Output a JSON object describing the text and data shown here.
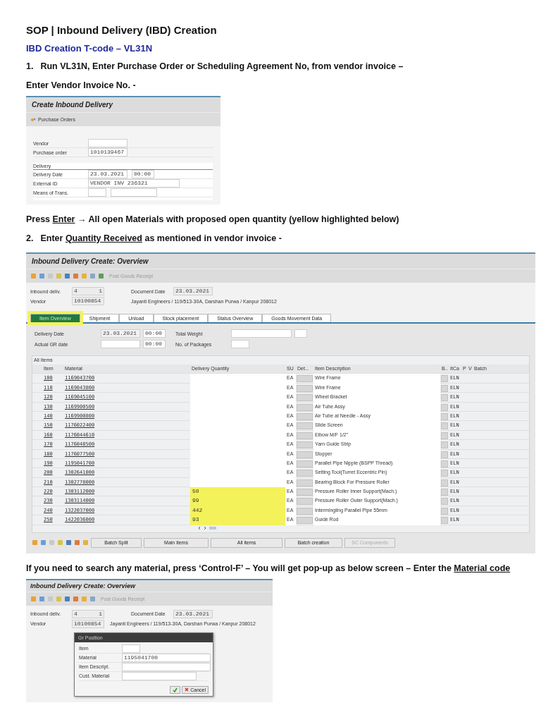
{
  "title": "SOP | Inbound Delivery (IBD) Creation",
  "subtitle": "IBD Creation T-code – VL31N",
  "step1": {
    "number": "1.",
    "text": [
      {
        "text": "Run VL31N, Enter Purchase Order or Scheduling Agreement No, from vendor invoice –",
        "underline": false
      }
    ]
  },
  "note1": [
    {
      "text": "Enter Vendor Invoice No. -",
      "underline": false
    }
  ],
  "screen1": {
    "title": "Create Inbound Delivery",
    "toolbar_button": "Purchase Orders",
    "fields": [
      {
        "label": "Vendor",
        "inputs": [
          {
            "kind": "empty"
          }
        ]
      },
      {
        "label": "Purchase order",
        "inputs": [
          {
            "kind": "filled",
            "value": "1010139467"
          }
        ]
      }
    ],
    "group": "Delivery",
    "group_fields": [
      {
        "label": "Delivery Date",
        "inputs": [
          {
            "kind": "filled",
            "value": "23.03.2021"
          },
          {
            "kind": "filled",
            "value": "00:00"
          }
        ]
      },
      {
        "label": "External ID",
        "inputs": [
          {
            "kind": "filled",
            "value": "VENDOR INV 236321"
          }
        ]
      },
      {
        "label": "Means of Trans.",
        "inputs": [
          {
            "kind": "empty"
          },
          {
            "kind": "empty"
          }
        ]
      }
    ]
  },
  "note2": [
    {
      "text": "Press ",
      "underline": false
    },
    {
      "text": "Enter",
      "underline": true
    },
    {
      "text": " → All open Materials with proposed open quantity (yellow highlighted below)",
      "underline": false
    }
  ],
  "step2": {
    "number": "2.",
    "text": [
      {
        "text": "Enter ",
        "underline": false
      },
      {
        "text": "Quantity Received",
        "underline": true
      },
      {
        "text": " as mentioned in vendor invoice -",
        "underline": false
      }
    ]
  },
  "screen2": {
    "title": "Inbound Delivery  Create: Overview",
    "toolbar_button": {
      "label": "Post Goods Receipt",
      "disabled": true
    },
    "header": {
      "inbound_label": "Inbound deliv.",
      "inbound_values": [
        "4",
        "1"
      ],
      "date_label": "Document Date",
      "date": "23.03.2021",
      "vendor_label": "Vendor",
      "vendor": "10100854",
      "address": "Jayanti Engineers / 119/513-30A, Darshan Purwa / Kanpur 208012"
    },
    "tabs": [
      {
        "label": "Item Overview",
        "selected": true,
        "highlighted": true
      },
      {
        "label": "Shipment",
        "selected": false,
        "highlighted": false
      },
      {
        "label": "Unload",
        "selected": false,
        "highlighted": false
      },
      {
        "label": "Stock placement",
        "selected": false,
        "highlighted": false
      },
      {
        "label": "Status Overview",
        "selected": false,
        "highlighted": false
      },
      {
        "label": "Goods Movement Data",
        "selected": false,
        "highlighted": false
      }
    ],
    "fields": {
      "delivery_date_label": "Delivery Date",
      "delivery_date": "23.03.2021",
      "delivery_time": "00:00",
      "gr_date_label": "Actual GR date",
      "gr_time": "00:00",
      "weight_label": "Total Weight",
      "packages_label": "No. of Packages"
    },
    "table": {
      "title": "All Items",
      "columns": [
        "Item",
        "Material",
        "Delivery Quantity",
        "SU",
        "Det...",
        "Item Description",
        "B..",
        "ItCa",
        "P",
        "V",
        "Batch"
      ],
      "rows": [
        {
          "item": "100",
          "material": "1169043700",
          "quantity": "",
          "su": "EA",
          "description": "Wire Frame",
          "itca": "ELN",
          "highlighted": false
        },
        {
          "item": "110",
          "material": "1169043800",
          "quantity": "",
          "su": "EA",
          "description": "Wire Frame",
          "itca": "ELN",
          "highlighted": false
        },
        {
          "item": "120",
          "material": "1169045100",
          "quantity": "",
          "su": "EA",
          "description": "Wheel Bracket",
          "itca": "ELN",
          "highlighted": false
        },
        {
          "item": "130",
          "material": "1169900500",
          "quantity": "",
          "su": "EA",
          "description": "Air Tube Assy",
          "itca": "ELN",
          "highlighted": false
        },
        {
          "item": "140",
          "material": "1169900800",
          "quantity": "",
          "su": "EA",
          "description": "Air Tube at Needle - Assy",
          "itca": "ELN",
          "highlighted": false
        },
        {
          "item": "150",
          "material": "1176022400",
          "quantity": "",
          "su": "EA",
          "description": "Slide Screen",
          "itca": "ELN",
          "highlighted": false
        },
        {
          "item": "160",
          "material": "1176044610",
          "quantity": "",
          "su": "EA",
          "description": "Elbow M/F 1/2\"",
          "itca": "ELN",
          "highlighted": false
        },
        {
          "item": "170",
          "material": "1176048500",
          "quantity": "",
          "su": "EA",
          "description": "Yarn Guide Strip",
          "itca": "ELN",
          "highlighted": false
        },
        {
          "item": "180",
          "material": "1176077500",
          "quantity": "",
          "su": "EA",
          "description": "Stopper",
          "itca": "ELN",
          "highlighted": false
        },
        {
          "item": "190",
          "material": "1195041700",
          "quantity": "",
          "su": "EA",
          "description": "Parallel Pipe Nipple (BSPP Thread)",
          "itca": "ELN",
          "highlighted": false
        },
        {
          "item": "200",
          "material": "1302641000",
          "quantity": "",
          "su": "EA",
          "description": "Setting Tool(Turret Eccentric Pin)",
          "itca": "ELN",
          "highlighted": false
        },
        {
          "item": "210",
          "material": "1302778000",
          "quantity": "",
          "su": "EA",
          "description": "Bearing Block For Pressure Roller",
          "itca": "ELN",
          "highlighted": false
        },
        {
          "item": "220",
          "material": "1303112000",
          "quantity": "50",
          "su": "EA",
          "description": "Pressure Roller Inner Support(Mach.)",
          "itca": "ELN",
          "highlighted": true
        },
        {
          "item": "230",
          "material": "1303114000",
          "quantity": "99",
          "su": "EA",
          "description": "Pressure Roller Outer Support(Mach.)",
          "itca": "ELN",
          "highlighted": true
        },
        {
          "item": "240",
          "material": "1322037000",
          "quantity": "442",
          "su": "EA",
          "description": "Intermingling Parallel Pipe 55mm",
          "itca": "ELN",
          "highlighted": true
        },
        {
          "item": "250",
          "material": "1422036000",
          "quantity": "93",
          "su": "EA",
          "description": "Guide Rod",
          "itca": "ELN",
          "highlighted": true
        }
      ]
    },
    "buttons": [
      {
        "label": "Batch Split",
        "disabled": false
      },
      {
        "label": "Main items",
        "disabled": false
      },
      {
        "label": "All items",
        "disabled": false
      },
      {
        "label": "Batch creation",
        "disabled": false
      },
      {
        "label": "SC Components",
        "disabled": true
      }
    ]
  },
  "note3": [
    {
      "text": "If you need to search any material, press ‘Control-F’ – You will get pop-up as below screen – Enter the ",
      "underline": false
    },
    {
      "text": "Material code",
      "underline": true
    }
  ],
  "screen3": {
    "title": "Inbound Delivery  Create: Overview",
    "toolbar_button": {
      "label": "Post Goods Receipt",
      "disabled": true
    },
    "header": {
      "inbound_label": "Inbound deliv.",
      "inbound_values": [
        "4",
        "1"
      ],
      "date_label": "Document Date",
      "date": "23.03.2021",
      "vendor_label": "Vendor",
      "vendor": "10100854",
      "address": "Jayanti Engineers / 119/513-30A, Darshan Purwa / Kanpur 208012"
    },
    "dialog": {
      "title": "Gr Position",
      "fields": [
        {
          "label": "Item"
        },
        {
          "label": "Material",
          "value": "1195041700"
        },
        {
          "label": "Item Descript."
        },
        {
          "label": "Cust. Material"
        }
      ],
      "cancel": "Cancel"
    }
  }
}
